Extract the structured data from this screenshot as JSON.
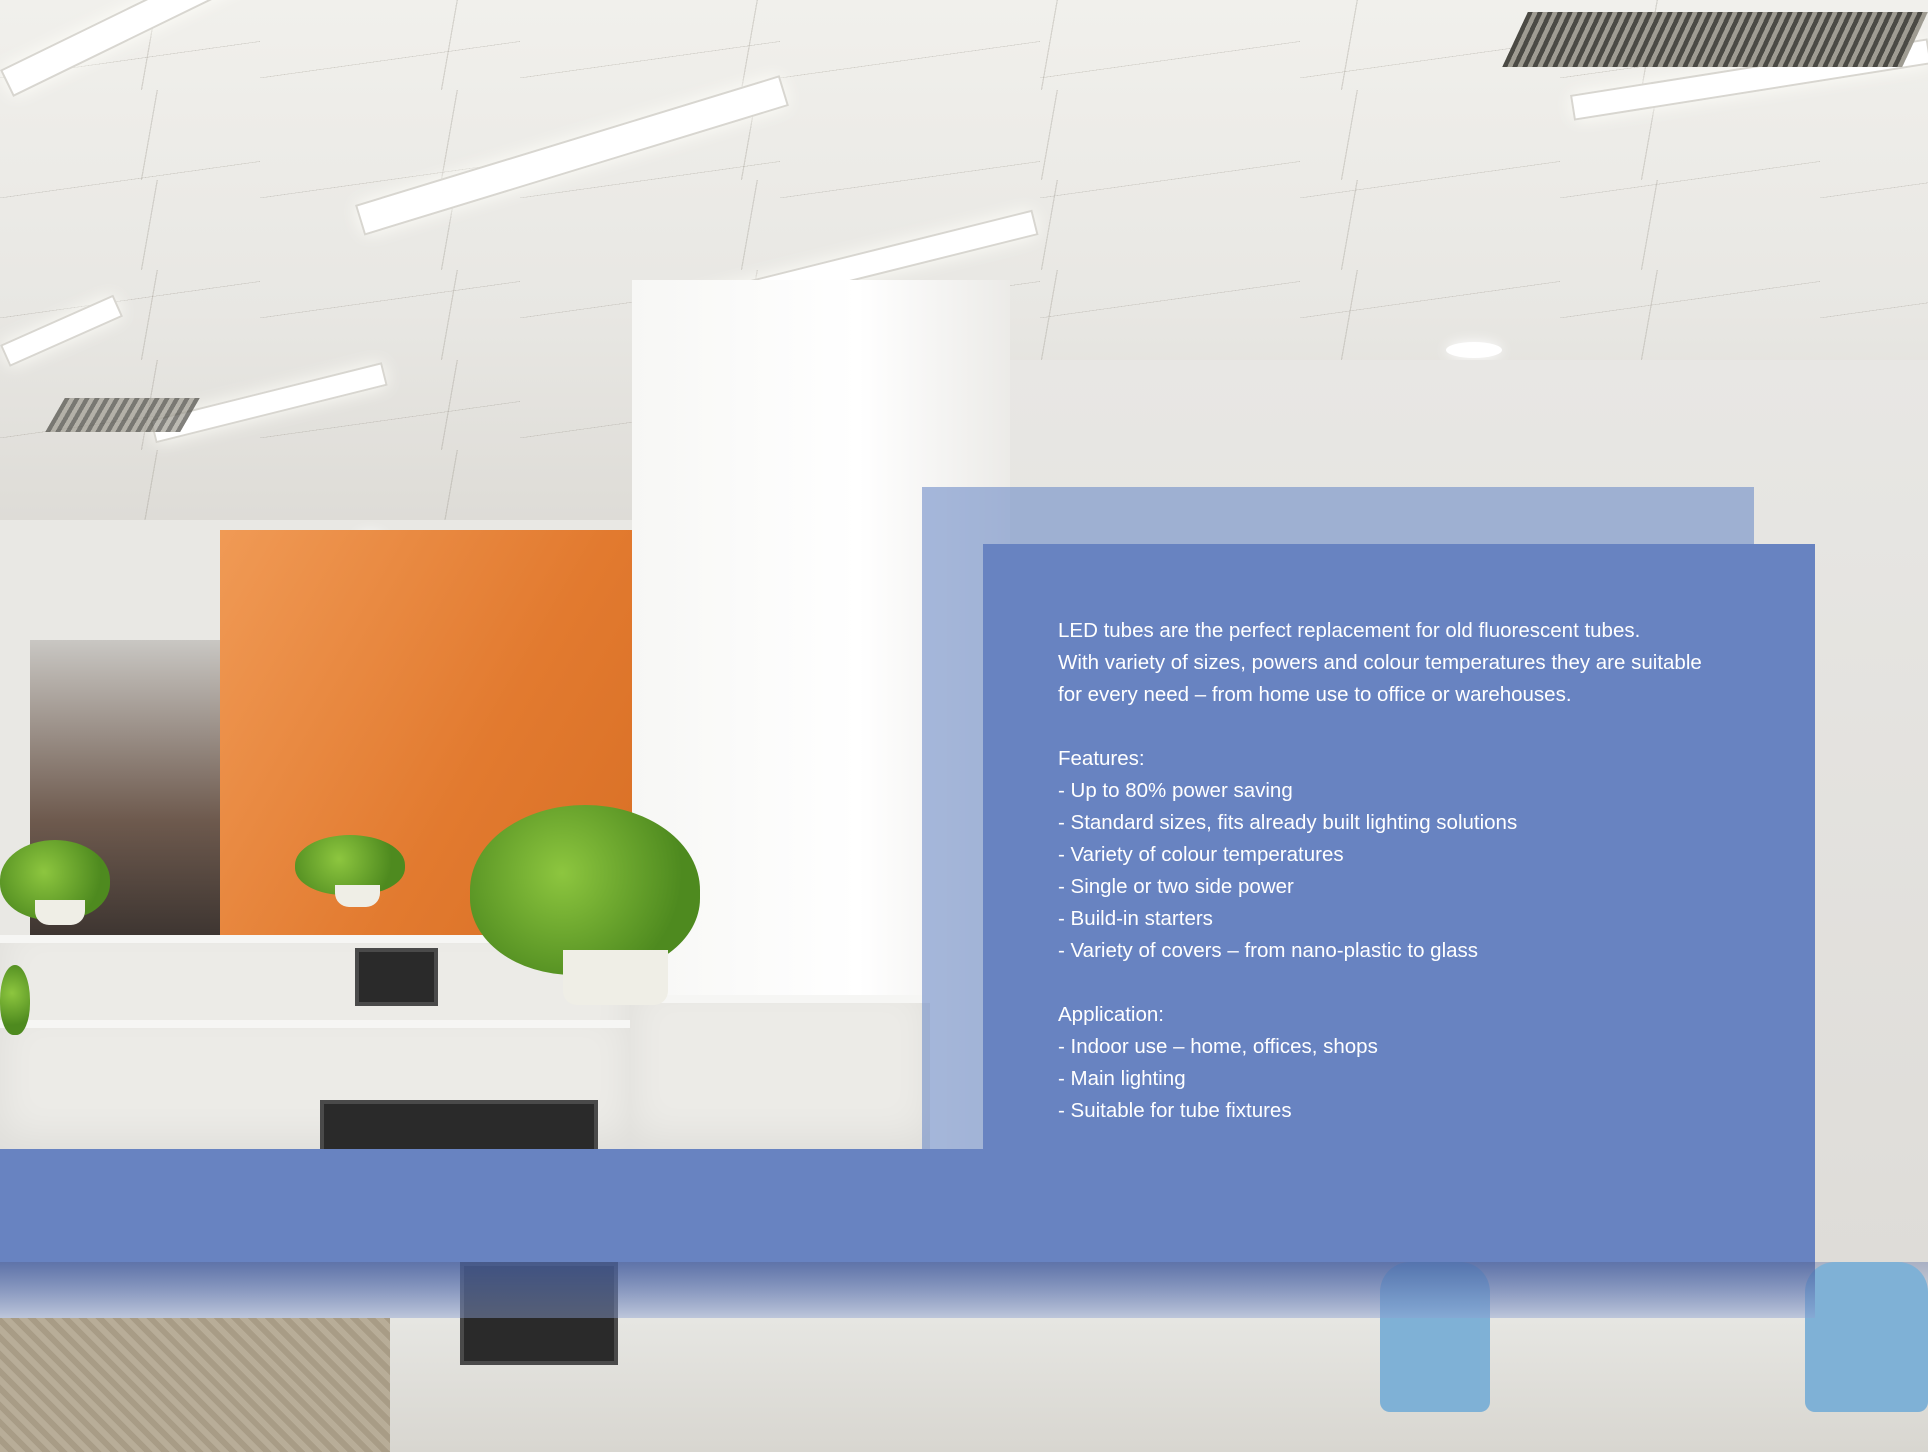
{
  "intro": [
    "LED tubes are the perfect replacement for old fluorescent tubes.",
    "With variety of sizes, powers and colour temperatures they are suitable",
    "for every need – from home use to office or warehouses."
  ],
  "features": {
    "heading": "Features:",
    "items": [
      "- Up to 80% power saving",
      "- Standard sizes, fits already built lighting solutions",
      "- Variety of colour temperatures",
      "- Single or two side power",
      "- Build-in starters",
      "- Variety of covers – from nano-plastic to glass"
    ]
  },
  "application": {
    "heading": "Application:",
    "items": [
      "- Indoor use – home, offices, shops",
      "- Main lighting",
      "- Suitable for tube fixtures"
    ]
  },
  "colors": {
    "panel": "#6883c1",
    "panel_translucent": "#6e8cc8",
    "text": "#ffffff"
  }
}
